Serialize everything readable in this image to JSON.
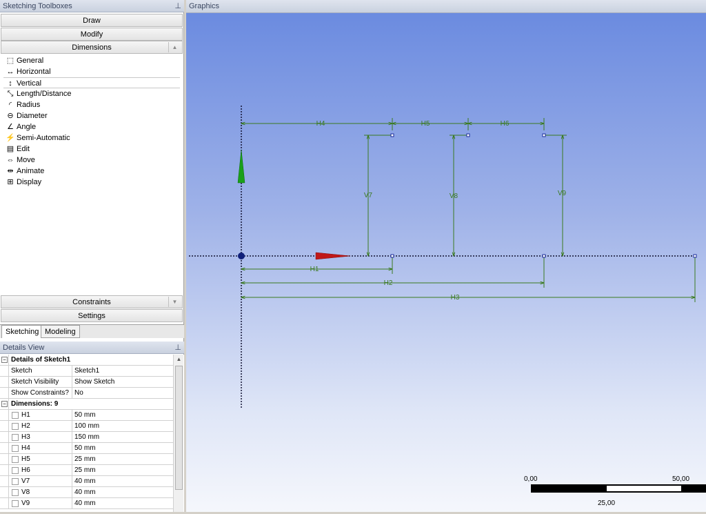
{
  "toolbox": {
    "title": "Sketching Toolboxes",
    "groups": {
      "draw": "Draw",
      "modify": "Modify",
      "dimensions": "Dimensions",
      "constraints": "Constraints",
      "settings": "Settings"
    },
    "tools": [
      {
        "label": "General",
        "icon": "ruler-icon",
        "glyph": "⬚"
      },
      {
        "label": "Horizontal",
        "icon": "horizontal-dim-icon",
        "glyph": "↔"
      },
      {
        "label": "Vertical",
        "icon": "vertical-dim-icon",
        "glyph": "↕"
      },
      {
        "label": "Length/Distance",
        "icon": "length-icon",
        "glyph": "⤡"
      },
      {
        "label": "Radius",
        "icon": "radius-icon",
        "glyph": "◜"
      },
      {
        "label": "Diameter",
        "icon": "diameter-icon",
        "glyph": "⊖"
      },
      {
        "label": "Angle",
        "icon": "angle-icon",
        "glyph": "∠"
      },
      {
        "label": "Semi-Automatic",
        "icon": "semi-automatic-icon",
        "glyph": "⚡"
      },
      {
        "label": "Edit",
        "icon": "edit-icon",
        "glyph": "▤"
      },
      {
        "label": "Move",
        "icon": "move-icon",
        "glyph": "⇔"
      },
      {
        "label": "Animate",
        "icon": "animate-icon",
        "glyph": "⇹"
      },
      {
        "label": "Display",
        "icon": "display-icon",
        "glyph": "⊞"
      }
    ],
    "selected_tool": "Vertical"
  },
  "tabs": {
    "sketching": "Sketching",
    "modeling": "Modeling"
  },
  "details": {
    "title": "Details View",
    "section1": "Details of Sketch1",
    "rows1": [
      {
        "key": "Sketch",
        "value": "Sketch1"
      },
      {
        "key": "Sketch Visibility",
        "value": "Show Sketch"
      },
      {
        "key": "Show Constraints?",
        "value": "No"
      }
    ],
    "section2": "Dimensions: 9",
    "dims": [
      {
        "key": "H1",
        "value": "50 mm"
      },
      {
        "key": "H2",
        "value": "100 mm"
      },
      {
        "key": "H3",
        "value": "150 mm"
      },
      {
        "key": "H4",
        "value": "50 mm"
      },
      {
        "key": "H5",
        "value": "25 mm"
      },
      {
        "key": "H6",
        "value": "25 mm"
      },
      {
        "key": "V7",
        "value": "40 mm"
      },
      {
        "key": "V8",
        "value": "40 mm"
      },
      {
        "key": "V9",
        "value": "40 mm"
      }
    ]
  },
  "graphics": {
    "title": "Graphics",
    "dimension_labels": {
      "h1": "H1",
      "h2": "H2",
      "h3": "H3",
      "h4": "H4",
      "h5": "H5",
      "h6": "H6",
      "v7": "V7",
      "v8": "V8",
      "v9": "V9"
    },
    "scale": {
      "left": "0,00",
      "right": "50,00",
      "middle": "25,00"
    },
    "colors": {
      "dimension": "#3a7a1e",
      "point": "#1a2a9c",
      "x_axis": "#c01818",
      "y_axis": "#1aa01a"
    }
  }
}
